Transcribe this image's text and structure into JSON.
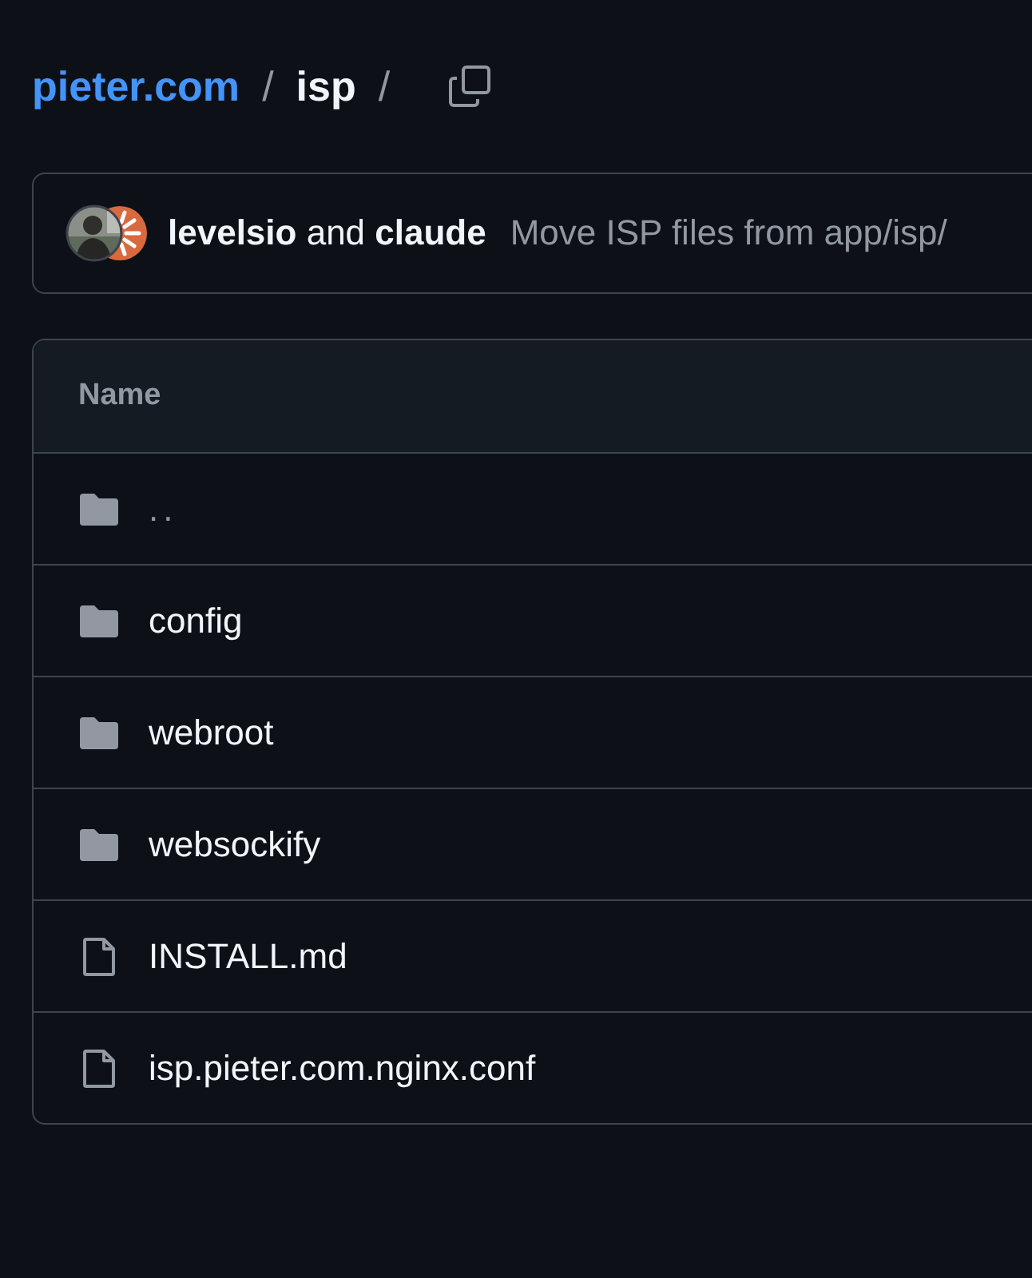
{
  "breadcrumb": [
    {
      "label": "pieter.com",
      "kind": "link"
    },
    {
      "label": "/",
      "kind": "separator"
    },
    {
      "label": "isp",
      "kind": "current"
    },
    {
      "label": "/",
      "kind": "separator"
    }
  ],
  "commit": {
    "authors": "**levelsio** and **claude**",
    "message": "Move ISP files from app/isp/"
  },
  "table": {
    "columns": [
      "Name"
    ],
    "rows": [
      {
        "name": "..",
        "kind": "parent"
      },
      {
        "name": "config",
        "kind": "folder"
      },
      {
        "name": "webroot",
        "kind": "folder"
      },
      {
        "name": "websockify",
        "kind": "folder"
      },
      {
        "name": "INSTALL.md",
        "kind": "file"
      },
      {
        "name": "isp.pieter.com.nginx.conf",
        "kind": "file"
      }
    ]
  }
}
